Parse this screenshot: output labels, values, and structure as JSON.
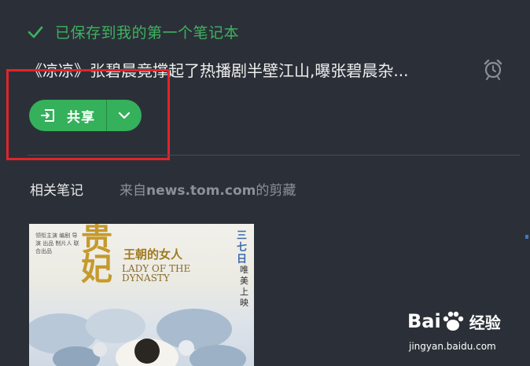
{
  "status": {
    "saved_text": "已保存到我的第一个笔记本",
    "icon": "check-icon",
    "color": "#3fb15f"
  },
  "note": {
    "title": "《凉凉》张碧晨竟撑起了热播剧半壁江山,曝张碧晨杂...",
    "reminder_icon": "alarm-clock-icon"
  },
  "share": {
    "label": "共享",
    "icon": "share-icon",
    "dropdown_icon": "chevron-down-icon",
    "color": "#35b05b"
  },
  "related": {
    "label": "相关笔记",
    "source_prefix": "来自",
    "source_domain": "news.tom.com",
    "source_suffix": "的剪藏"
  },
  "poster": {
    "title_char_1": "贵",
    "title_char_2": "妃",
    "subtitle": "王朝的女人",
    "english_line_1": "LADY OF THE",
    "english_line_2": "DYNASTY",
    "release_vertical": "三七日",
    "release_vertical_2": "唯美上映"
  },
  "watermark": {
    "logo_text": "Bai",
    "logo_cn": "经验",
    "url": "jingyan.baidu.com"
  },
  "colors": {
    "background": "#2b3038",
    "highlight": "#e0242a"
  }
}
